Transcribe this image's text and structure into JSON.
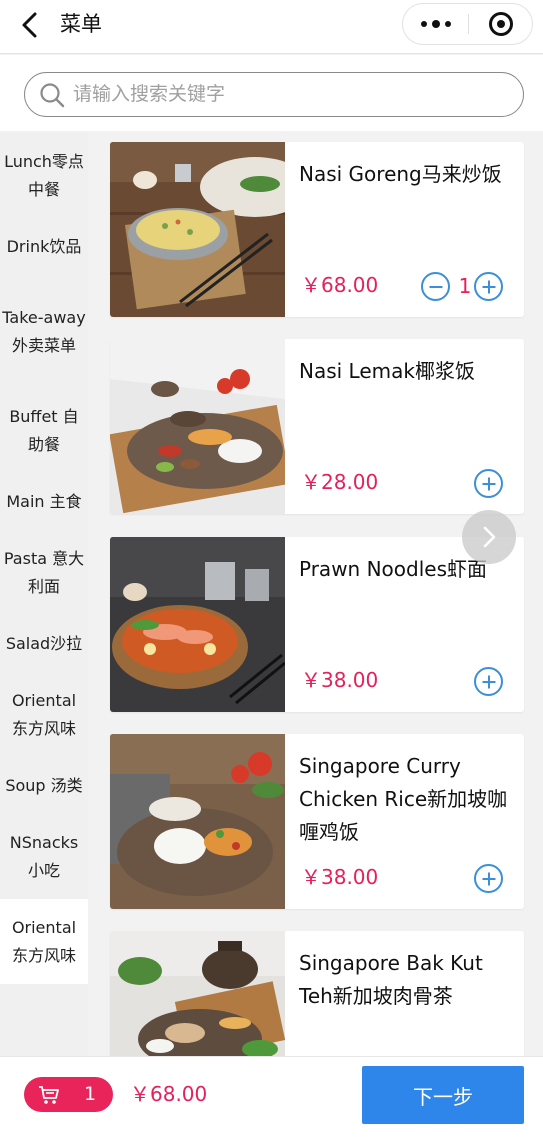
{
  "header": {
    "title": "菜单"
  },
  "search": {
    "placeholder": "请输入搜索关键字"
  },
  "sidebar": {
    "categories": [
      {
        "label": "Lunch零点中餐"
      },
      {
        "label": "Drink饮品"
      },
      {
        "label": "Take-away外卖菜单"
      },
      {
        "label": "Buffet 自助餐"
      },
      {
        "label": "Main 主食"
      },
      {
        "label": "Pasta 意大利面"
      },
      {
        "label": "Salad沙拉"
      },
      {
        "label": "Oriental 东方风味"
      },
      {
        "label": "Soup 汤类"
      },
      {
        "label": "NSnacks 小吃"
      },
      {
        "label": "Oriental 东方风味",
        "active": true
      }
    ]
  },
  "menu": {
    "items": [
      {
        "name": "Nasi Goreng马来炒饭",
        "price": "￥68.00",
        "quantity": "1"
      },
      {
        "name": "Nasi Lemak椰浆饭",
        "price": "￥28.00"
      },
      {
        "name": "Prawn Noodles虾面",
        "price": "￥38.00"
      },
      {
        "name": "Singapore Curry Chicken Rice新加坡咖喱鸡饭",
        "price": "￥38.00"
      },
      {
        "name": "Singapore Bak Kut Teh新加坡肉骨茶",
        "price": ""
      }
    ]
  },
  "footer": {
    "cart_count": "1",
    "total": "￥68.00",
    "next_label": "下一步"
  },
  "colors": {
    "accent": "#e4215b",
    "primary": "#2f86ea",
    "stepper": "#3b8fd8"
  },
  "icons": [
    "back-arrow-icon",
    "more-dots-icon",
    "close-target-icon",
    "search-icon",
    "minus-icon",
    "plus-icon",
    "cart-icon",
    "chevron-right-icon"
  ]
}
